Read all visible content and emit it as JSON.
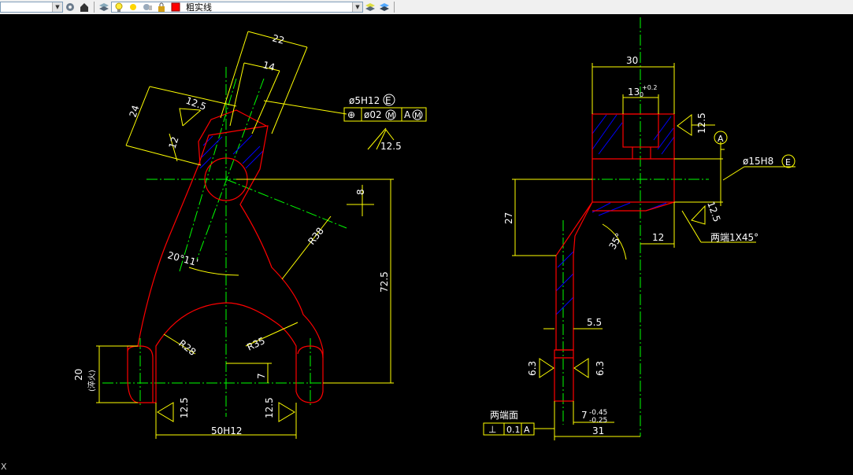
{
  "toolbar": {
    "layer_value": "粗实线",
    "icons": [
      "layers-icon",
      "settings-icon",
      "home-icon",
      "layer-state-icon",
      "bulb-on-icon",
      "sun-icon",
      "lock-icon",
      "color-swatch-icon",
      "layer-match-icon",
      "layer-previous-icon"
    ],
    "colors": {
      "swatch_red": "#ff0000",
      "swatch_yellow": "#ffff00"
    }
  },
  "drawing": {
    "colors": {
      "background": "#000000",
      "outline": "#ff0000",
      "dimension": "#ffff00",
      "centerline": "#00ff00",
      "hatch": "#0000ff",
      "text": "#ffffff"
    },
    "front_view": {
      "dims": {
        "d22": "22",
        "d14": "14",
        "d24": "24",
        "d12a": "12",
        "r12_5": "12.5",
        "hole_callout": "ø5H12",
        "hole_e": "E",
        "fcf_symbol": "⊕",
        "fcf_tol": "ø02",
        "fcf_m1": "M",
        "fcf_datum": "A",
        "fcf_m2": "M",
        "rough_12_5_top": "12.5",
        "d8": "8",
        "r38": "R38",
        "angle": "20°11'",
        "d72_5": "72.5",
        "r28": "R28",
        "r35": "R35",
        "d7": "7",
        "d20": "20",
        "d20_note": "(淬火)",
        "rough_left": "12.5",
        "rough_right": "12.5",
        "d50": "50H12"
      }
    },
    "side_view": {
      "dims": {
        "d30": "30",
        "d13": "13",
        "d13_tol_upper": "+0.2",
        "d13_tol_lower": "0",
        "rough_12_5_a": "12.5",
        "datum_a": "A",
        "d15": "ø15H8",
        "d15_e": "E",
        "d27": "27",
        "rough_12_5_b": "12.5",
        "chamfer_note": "两端1X45°",
        "angle35": "35°",
        "d12": "12",
        "d5_5": "5.5",
        "rough_6_3_left": "6.3",
        "rough_6_3_right": "6.3",
        "ends_note": "两端面",
        "perp_symbol": "⊥",
        "perp_tol": "0.1",
        "perp_datum": "A",
        "d7": "7",
        "d7_upper": "-0.45",
        "d7_lower": "-0.25",
        "d31": "31"
      }
    }
  },
  "status": {
    "cursor_glyph": "X"
  }
}
